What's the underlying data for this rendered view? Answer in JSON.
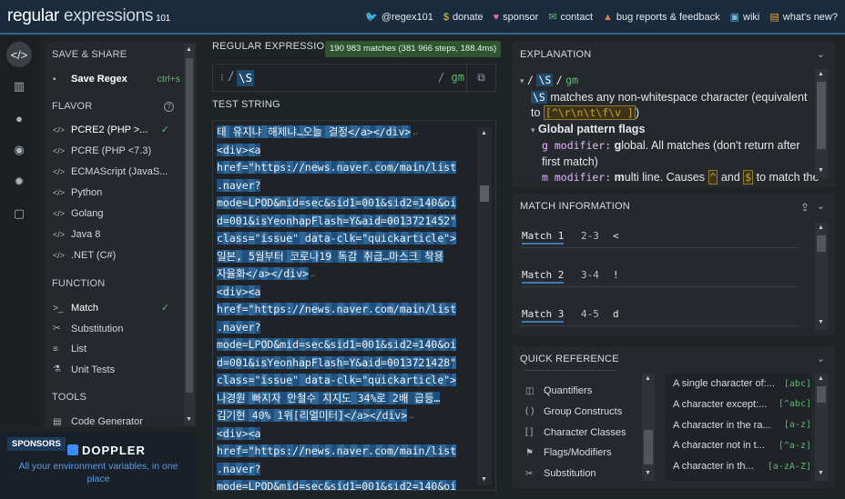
{
  "header": {
    "logo_main": "regular",
    "logo_light": " expressions",
    "logo_version": "101",
    "links": [
      {
        "icon": "twitter-icon",
        "glyph": "🐦",
        "label": "@regex101",
        "color": "#4ea1e6"
      },
      {
        "icon": "dollar-icon",
        "glyph": "$",
        "label": "donate",
        "color": "#e4c04a"
      },
      {
        "icon": "heart-icon",
        "glyph": "♥",
        "label": "sponsor",
        "color": "#e56bb0"
      },
      {
        "icon": "mail-icon",
        "glyph": "✉",
        "label": "contact",
        "color": "#5cba6e"
      },
      {
        "icon": "warning-icon",
        "glyph": "▲",
        "label": "bug reports & feedback",
        "color": "#e07a5a"
      },
      {
        "icon": "book-icon",
        "glyph": "▣",
        "label": "wiki",
        "color": "#6fb7d6"
      },
      {
        "icon": "news-icon",
        "glyph": "▤",
        "label": "what's new?",
        "color": "#e0a43a"
      }
    ]
  },
  "sidebar": {
    "save_share": "SAVE & SHARE",
    "save_regex": "Save Regex",
    "save_shortcut": "ctrl+s",
    "flavor": "FLAVOR",
    "flavors": [
      "PCRE2 (PHP >...",
      "PCRE (PHP <7.3)",
      "ECMAScript (JavaS...",
      "Python",
      "Golang",
      "Java 8",
      ".NET (C#)"
    ],
    "function": "FUNCTION",
    "functions": [
      "Match",
      "Substitution",
      "List",
      "Unit Tests"
    ],
    "tools": "TOOLS",
    "tools_items": [
      "Code Generator"
    ]
  },
  "sponsors": {
    "tag": "SPONSORS",
    "brand": "DOPPLER",
    "text": "All your environment variables, in one place"
  },
  "regex": {
    "heading": "REGULAR EXPRESSION",
    "badge": "190 983 matches (381 966 steps, 188.4ms)",
    "delimiter_open": "/",
    "pattern": "\\S",
    "delimiter_close": "/",
    "flags": "gm"
  },
  "test": {
    "heading": "TEST STRING",
    "lines": [
      "태 유지냐 해제냐…오늘 결정</a></div>",
      "<div><a",
      "href=\"https://news.naver.com/main/list",
      ".naver?",
      "mode=LPOD&mid=sec&sid1=001&sid2=140&oi",
      "d=001&isYeonhapFlash=Y&aid=0013721452\"",
      "class=\"issue\" data-clk=\"quickarticle\">",
      "일본, 5월부터 코로나19 독감 취급…마스크 착용",
      "자율화</a></div>",
      "<div><a",
      "href=\"https://news.naver.com/main/list",
      ".naver?",
      "mode=LPOD&mid=sec&sid1=001&sid2=140&oi",
      "d=001&isYeonhapFlash=Y&aid=0013721428\"",
      "class=\"issue\" data-clk=\"quickarticle\">",
      "나경원 빠지자 안철수 지지도 34%로 2배 급등…",
      "김기현 40% 1위[리얼미터]</a></div>",
      "<div><a",
      "href=\"https://news.naver.com/main/list",
      ".naver?",
      "mode=LPOD&mid=sec&sid1=001&sid2=140&oi"
    ],
    "line_end_marks": [
      true,
      false,
      false,
      false,
      false,
      false,
      false,
      false,
      true,
      false,
      false,
      false,
      false,
      false,
      false,
      false,
      true,
      false,
      false,
      false,
      false
    ]
  },
  "explanation": {
    "heading": "EXPLANATION",
    "pattern_open": "/",
    "pattern": "\\S",
    "pattern_close": "/",
    "flags": "gm",
    "token": "\\S",
    "token_desc": " matches any non-whitespace character (equivalent to ",
    "token_equiv": "[^\\r\\n\\t\\f\\v ]",
    "token_close": ")",
    "global_flags": "Global pattern flags",
    "g_mod": "g modifier:",
    "g_bold": "g",
    "g_desc": "lobal. All matches (don't return after first match)",
    "m_mod": "m modifier:",
    "m_bold": "m",
    "m_desc_1": "ulti line. Causes ",
    "m_caret": "^",
    "m_and": " and ",
    "m_dollar": "$",
    "m_desc_2": " to match the"
  },
  "match_info": {
    "heading": "MATCH INFORMATION",
    "matches": [
      {
        "name": "Match 1",
        "range": "2-3",
        "value": "<"
      },
      {
        "name": "Match 2",
        "range": "3-4",
        "value": "!"
      },
      {
        "name": "Match 3",
        "range": "4-5",
        "value": "d"
      }
    ]
  },
  "quick_ref": {
    "heading": "QUICK REFERENCE",
    "categories": [
      {
        "icon": "quantifier-icon",
        "glyph": "◫",
        "label": "Quantifiers"
      },
      {
        "icon": "group-icon",
        "glyph": "( )",
        "label": "Group Constructs"
      },
      {
        "icon": "class-icon",
        "glyph": "[ ]",
        "label": "Character Classes"
      },
      {
        "icon": "flag-icon",
        "glyph": "⚑",
        "label": "Flags/Modifiers"
      },
      {
        "icon": "substitution-icon",
        "glyph": "✂",
        "label": "Substitution"
      }
    ],
    "tokens": [
      {
        "label": "A single character of:...",
        "code": "[abc]"
      },
      {
        "label": "A character except:...",
        "code": "[^abc]"
      },
      {
        "label": "A character in the ra...",
        "code": "[a-z]"
      },
      {
        "label": "A character not in t...",
        "code": "[^a-z]"
      },
      {
        "label": "A character in th...",
        "code": "[a-zA-Z]"
      }
    ]
  }
}
